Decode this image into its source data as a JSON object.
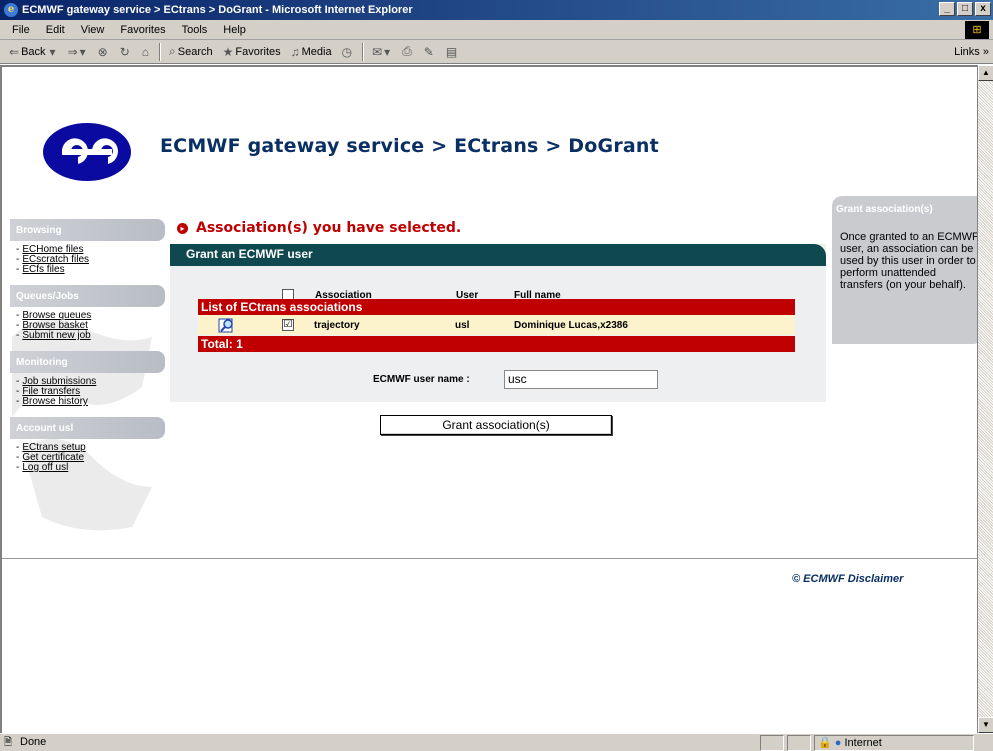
{
  "window": {
    "title": "ECMWF gateway service > ECtrans > DoGrant - Microsoft Internet Explorer",
    "buttons": [
      "_",
      "□",
      "x"
    ]
  },
  "menu": [
    "File",
    "Edit",
    "View",
    "Favorites",
    "Tools",
    "Help"
  ],
  "toolbar": {
    "back": "Back",
    "search": "Search",
    "favorites": "Favorites",
    "media": "Media",
    "links": "Links"
  },
  "page": {
    "title": "ECMWF gateway service > ECtrans > DoGrant",
    "selection_heading": "Association(s) you have selected."
  },
  "nav": {
    "browsing": {
      "title": "Browsing",
      "links": [
        "ECHome files",
        "ECscratch files",
        "ECfs files"
      ]
    },
    "queues": {
      "title": "Queues/Jobs",
      "links": [
        "Browse queues",
        "Browse basket",
        "Submit new job"
      ]
    },
    "monitoring": {
      "title": "Monitoring",
      "links": [
        "Job submissions",
        "File transfers",
        "Browse history"
      ]
    },
    "account": {
      "title": "Account usl",
      "links": [
        "ECtrans setup",
        "Get certificate",
        "Log off usl"
      ]
    }
  },
  "grant_panel": {
    "title": "Grant an ECMWF user",
    "columns": {
      "association": "Association",
      "user": "User",
      "full_name": "Full name"
    },
    "list_title": "List of ECtrans associations",
    "rows": [
      {
        "association": "trajectory",
        "user": "usl",
        "full_name": "Dominique Lucas,x2386",
        "checked": "☑"
      }
    ],
    "total": "Total: 1",
    "username_label": "ECMWF user name :",
    "username_value": "usc"
  },
  "grant_button": "Grant association(s)",
  "help": {
    "title": "Grant association(s)",
    "text": "Once granted to an ECMWF user, an association can be used by this user in order to perform unattended transfers (on your behalf)."
  },
  "footer": "© ECMWF  Disclaimer",
  "status": {
    "left": "Done",
    "zone": "Internet"
  }
}
